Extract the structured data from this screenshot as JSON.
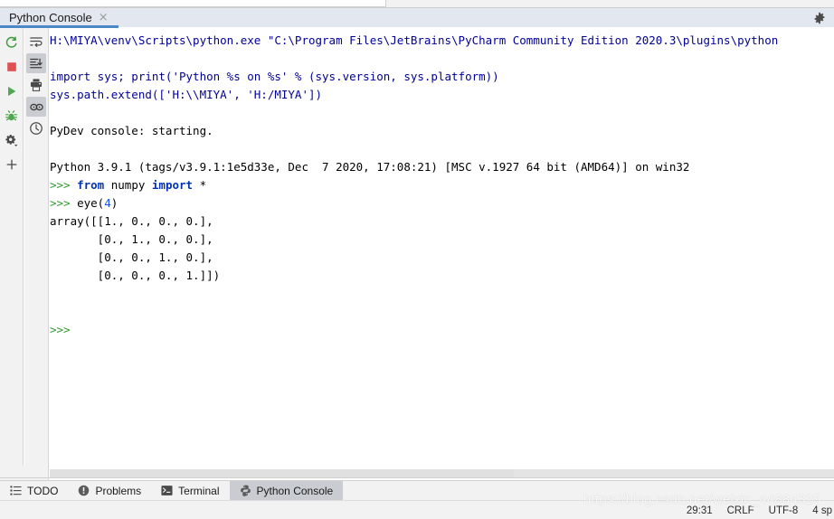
{
  "colors": {
    "accent_underline": "#4a88c7",
    "prompt_green": "#2e9b2e",
    "keyword_blue": "#0033b3",
    "number_blue": "#1750eb",
    "command_blue": "#000096",
    "active_tab_bg": "#c9cdd1",
    "toolbar_bg": "#f2f2f2",
    "header_bg": "#e3e7ef"
  },
  "tool_window": {
    "tab_label": "Python Console",
    "close_label": "×",
    "settings_icon": "gear-icon"
  },
  "left_toolbar": {
    "primary": [
      {
        "name": "rerun-icon",
        "label": "Rerun"
      },
      {
        "name": "stop-icon",
        "label": "Stop"
      },
      {
        "name": "run-icon",
        "label": "Execute"
      },
      {
        "name": "debug-icon",
        "label": "Attach Debugger"
      },
      {
        "name": "settings-dropdown-icon",
        "label": "Settings"
      },
      {
        "name": "plus-icon",
        "label": "New Console"
      }
    ],
    "secondary": [
      {
        "name": "soft-wrap-icon",
        "label": "Use Soft Wraps",
        "pressed": false
      },
      {
        "name": "scroll-to-end-icon",
        "label": "Scroll to the end",
        "pressed": true
      },
      {
        "name": "print-icon",
        "label": "Print",
        "pressed": false
      },
      {
        "name": "show-console-variables-icon",
        "label": "Show Variables",
        "pressed": true
      },
      {
        "name": "history-icon",
        "label": "Browse History",
        "pressed": false
      }
    ]
  },
  "console": {
    "lines": [
      {
        "segments": [
          {
            "cls": "c-cmd",
            "text": "H:\\MIYA\\venv\\Scripts\\python.exe \"C:\\Program Files\\JetBrains\\PyCharm Community Edition 2020.3\\plugins\\python"
          }
        ]
      },
      {
        "segments": [
          {
            "cls": "c-plain",
            "text": ""
          }
        ]
      },
      {
        "segments": [
          {
            "cls": "c-cmd",
            "text": "import sys; print('Python %s on %s' % (sys.version, sys.platform))"
          }
        ]
      },
      {
        "segments": [
          {
            "cls": "c-cmd",
            "text": "sys.path.extend(['H:\\\\MIYA', 'H:/MIYA'])"
          }
        ]
      },
      {
        "segments": [
          {
            "cls": "c-plain",
            "text": ""
          }
        ]
      },
      {
        "segments": [
          {
            "cls": "c-plain",
            "text": "PyDev console: starting."
          }
        ]
      },
      {
        "segments": [
          {
            "cls": "c-plain",
            "text": ""
          }
        ]
      },
      {
        "segments": [
          {
            "cls": "c-plain",
            "text": "Python 3.9.1 (tags/v3.9.1:1e5d33e, Dec  7 2020, 17:08:21) [MSC v.1927 64 bit (AMD64)] on win32"
          }
        ]
      },
      {
        "segments": [
          {
            "cls": "c-prompt",
            "text": ">>> "
          },
          {
            "cls": "c-kw",
            "text": "from"
          },
          {
            "cls": "c-plain",
            "text": " numpy "
          },
          {
            "cls": "c-kw",
            "text": "import"
          },
          {
            "cls": "c-plain",
            "text": " *"
          }
        ]
      },
      {
        "segments": [
          {
            "cls": "c-prompt",
            "text": ">>> "
          },
          {
            "cls": "c-plain",
            "text": "eye("
          },
          {
            "cls": "c-num",
            "text": "4"
          },
          {
            "cls": "c-plain",
            "text": ")"
          }
        ]
      },
      {
        "segments": [
          {
            "cls": "c-plain",
            "text": "array([[1., 0., 0., 0.],"
          }
        ]
      },
      {
        "segments": [
          {
            "cls": "c-plain",
            "text": "       [0., 1., 0., 0.],"
          }
        ]
      },
      {
        "segments": [
          {
            "cls": "c-plain",
            "text": "       [0., 0., 1., 0.],"
          }
        ]
      },
      {
        "segments": [
          {
            "cls": "c-plain",
            "text": "       [0., 0., 0., 1.]])"
          }
        ]
      },
      {
        "segments": [
          {
            "cls": "c-plain",
            "text": ""
          }
        ]
      },
      {
        "segments": [
          {
            "cls": "c-plain",
            "text": ""
          }
        ]
      },
      {
        "segments": [
          {
            "cls": "c-prompt",
            "text": ">>>"
          }
        ]
      }
    ]
  },
  "bottom_bar": {
    "items": [
      {
        "icon": "todo-list-icon",
        "label": "TODO",
        "active": false
      },
      {
        "icon": "problems-icon",
        "label": "Problems",
        "active": false
      },
      {
        "icon": "terminal-icon",
        "label": "Terminal",
        "active": false
      },
      {
        "icon": "python-console-icon",
        "label": "Python Console",
        "active": true
      }
    ]
  },
  "status_bar": {
    "caret_position": "29:31",
    "line_separator": "CRLF",
    "encoding": "UTF-8",
    "indent": "4 sp"
  },
  "watermark": {
    "text": "https://blog.csdn.net/weixin_44884325"
  }
}
